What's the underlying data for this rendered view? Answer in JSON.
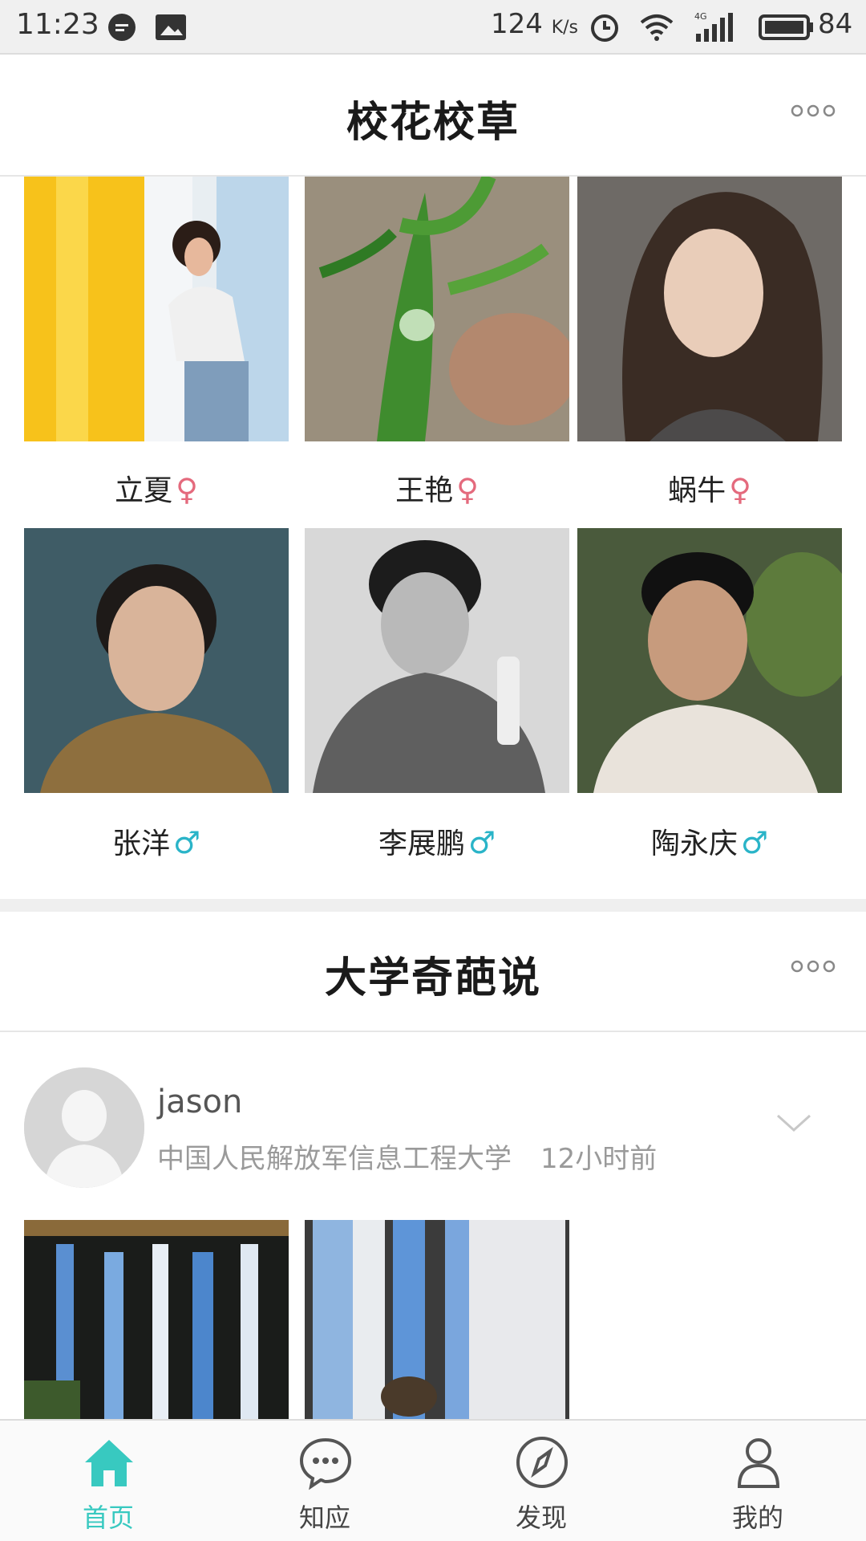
{
  "status_bar": {
    "time": "11:23",
    "net_speed": "124",
    "net_unit": "K/s",
    "network": "4G",
    "battery": "84"
  },
  "section1": {
    "title": "校花校草",
    "female_sign": "♀",
    "male_sign": "♂",
    "people": [
      {
        "name": "立夏",
        "gender": "female"
      },
      {
        "name": "王艳",
        "gender": "female"
      },
      {
        "name": "蜗牛",
        "gender": "female"
      },
      {
        "name": "张洋",
        "gender": "male"
      },
      {
        "name": "李展鹏",
        "gender": "male"
      },
      {
        "name": "陶永庆",
        "gender": "male"
      }
    ]
  },
  "section2": {
    "title": "大学奇葩说",
    "post": {
      "username": "jason",
      "school": "中国人民解放军信息工程大学",
      "time": "12小时前"
    }
  },
  "tabbar": {
    "items": [
      {
        "label": "首页",
        "icon": "home-icon",
        "active": true
      },
      {
        "label": "知应",
        "icon": "chat-bubble-icon",
        "active": false
      },
      {
        "label": "发现",
        "icon": "compass-icon",
        "active": false
      },
      {
        "label": "我的",
        "icon": "person-icon",
        "active": false
      }
    ]
  },
  "colors": {
    "accent": "#38c9c0",
    "female": "#e46a7d",
    "male": "#2ab4c8"
  }
}
